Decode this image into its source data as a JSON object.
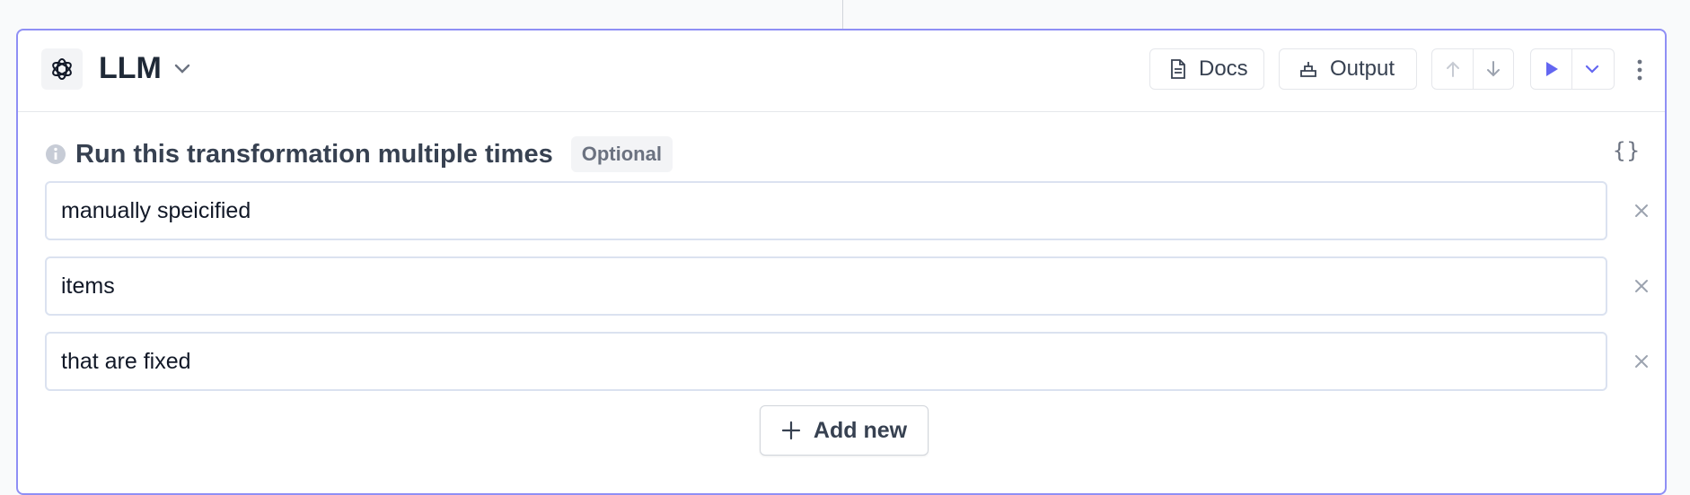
{
  "node": {
    "title": "LLM",
    "logo_icon": "openai-logo-icon"
  },
  "toolbar": {
    "docs_label": "Docs",
    "output_label": "Output"
  },
  "section": {
    "title": "Run this transformation multiple times",
    "badge": "Optional",
    "code_toggle": "{}"
  },
  "items": [
    {
      "value": "manually speicified"
    },
    {
      "value": "items"
    },
    {
      "value": "that are fixed"
    }
  ],
  "add_button_label": "Add new",
  "colors": {
    "accent": "#6366f1",
    "card_border": "#8f8ff5"
  }
}
